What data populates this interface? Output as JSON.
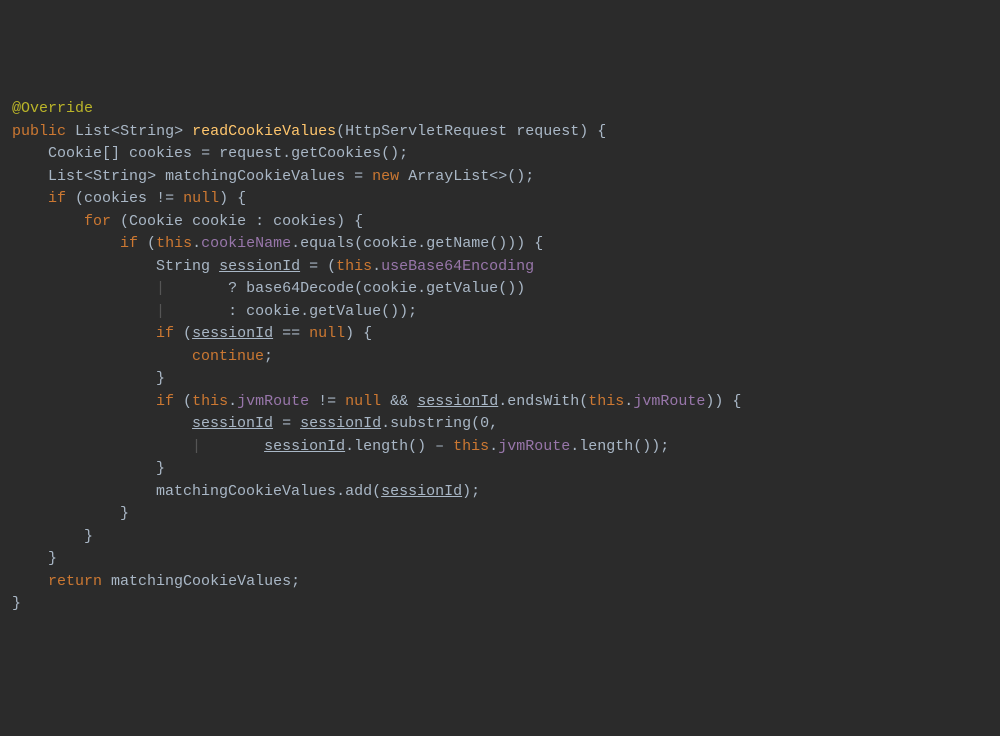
{
  "code": {
    "annotation_override": "@Override",
    "kw_public": "public",
    "type_List": "List",
    "type_String": "String",
    "method_readCookieValues": "readCookieValues",
    "type_HttpServletRequest": "HttpServletRequest",
    "param_request": "request",
    "type_CookieArr": "Cookie[]",
    "var_cookies": "cookies",
    "call_getCookies": "getCookies",
    "var_matchingCookieValues": "matchingCookieValues",
    "kw_new": "new",
    "type_ArrayList": "ArrayList",
    "kw_if": "if",
    "kw_null": "null",
    "kw_for": "for",
    "type_Cookie": "Cookie",
    "var_cookie": "cookie",
    "kw_this": "this",
    "field_cookieName": "cookieName",
    "call_equals": "equals",
    "call_getName": "getName",
    "var_sessionId": "sessionId",
    "field_useBase64Encoding": "useBase64Encoding",
    "call_base64Decode": "base64Decode",
    "call_getValue": "getValue",
    "kw_continue": "continue",
    "field_jvmRoute": "jvmRoute",
    "call_endsWith": "endsWith",
    "call_substring": "substring",
    "call_length": "length",
    "call_add": "add",
    "kw_return": "return",
    "op_eq": "==",
    "op_neq": "!=",
    "op_assign": "=",
    "op_and": "&&",
    "op_minus": "–",
    "op_ternary_q": "?",
    "op_ternary_c": ":",
    "num_zero": "0"
  }
}
